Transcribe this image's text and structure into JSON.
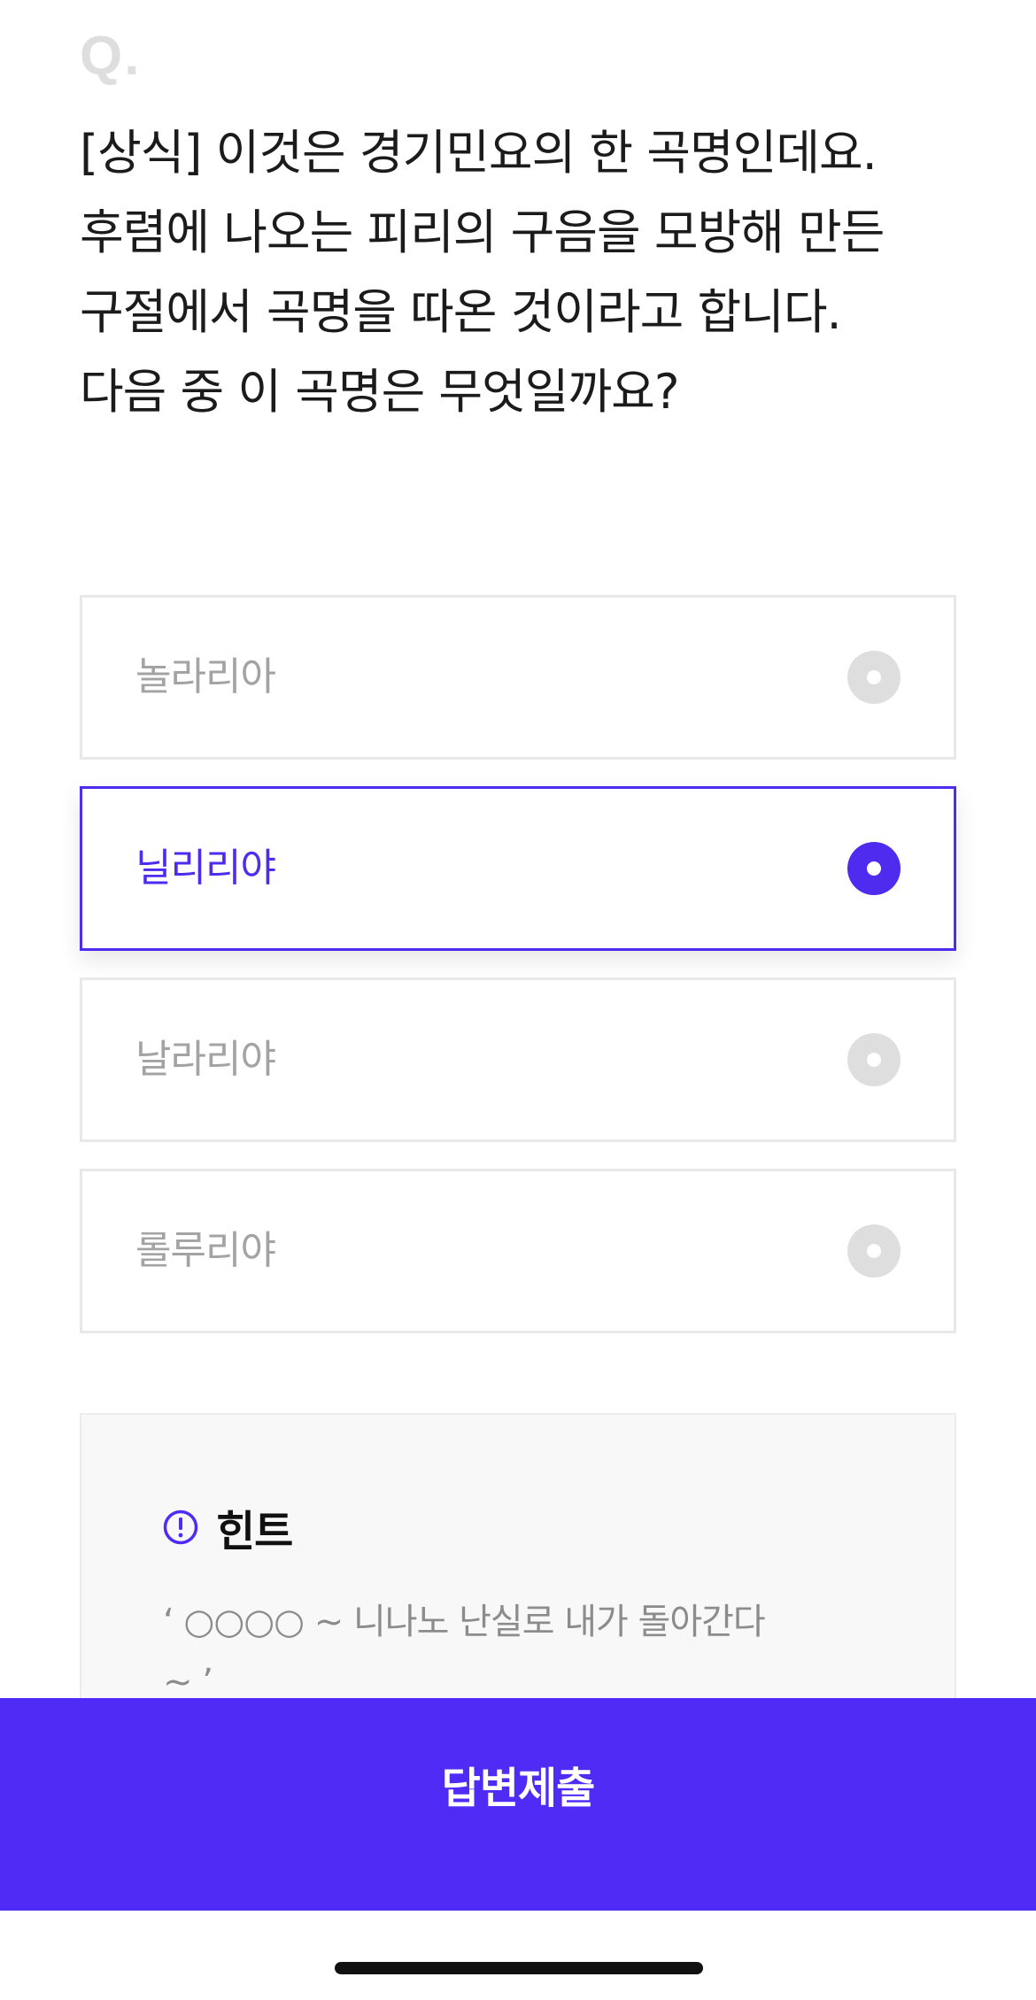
{
  "question": {
    "marker": "Q.",
    "text": "[상식] 이것은 경기민요의 한 곡명인데요. 후렴에 나오는 피리의 구음을 모방해 만든 구절에서 곡명을 따온 것이라고 합니다. 다음 중 이 곡명은 무엇일까요?"
  },
  "options": [
    {
      "label": "놀라리아",
      "selected": false
    },
    {
      "label": "닐리리야",
      "selected": true
    },
    {
      "label": "날라리야",
      "selected": false
    },
    {
      "label": "롤루리야",
      "selected": false
    }
  ],
  "hint": {
    "title": "힌트",
    "text": "‘ ○○○○ ~ 니나노 난실로 내가 돌아간다 ~ ’",
    "icon": "exclamation-circle-icon"
  },
  "submit": {
    "label": "답변제출"
  },
  "colors": {
    "accent": "#4f2bf5",
    "inactive_radio": "#dedede",
    "inactive_text": "#a3a3a3"
  }
}
